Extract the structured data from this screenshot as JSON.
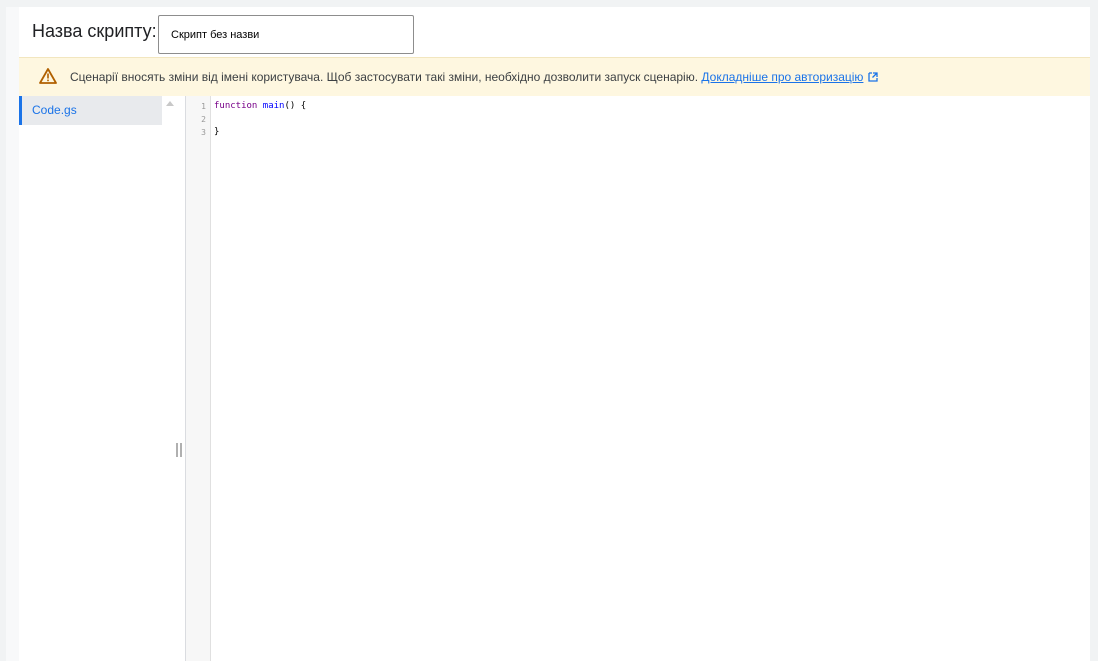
{
  "script_name": {
    "label": "Назва скрипту:",
    "value": "Скрипт без назви"
  },
  "warning": {
    "text": "Сценарії вносять зміни від імені користувача. Щоб застосувати такі зміни, необхідно дозволити запуск сценарію.",
    "link_label": "Докладніше про авторизацію",
    "icon": "warning-triangle-icon",
    "link_icon": "external-link-icon",
    "color": "#b06000"
  },
  "files": {
    "items": [
      {
        "label": "Code.gs",
        "selected": true
      }
    ]
  },
  "editor": {
    "line_numbers": [
      "1",
      "2",
      "3"
    ],
    "lines": {
      "line1": {
        "keyword": "function",
        "name": "main",
        "rest": "() {"
      },
      "line2": "",
      "line3": "}"
    }
  },
  "colors": {
    "accent": "#1a73e8",
    "warning_bg": "#fef7e0",
    "keyword": "#770088"
  }
}
